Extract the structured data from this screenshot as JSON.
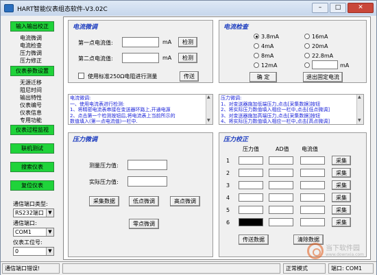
{
  "window": {
    "title": "HART智能仪表组态软件-V3.02C"
  },
  "left": {
    "btn_input_output": "输入输出校正",
    "items1": [
      "电流微调",
      "电流检查",
      "压力微调",
      "压力修正"
    ],
    "btn_params": "仪表参数设置",
    "items2": [
      "无源迁移",
      "阻尼时间",
      "输出特性",
      "仪表编号",
      "仪表信息",
      "专用功能"
    ],
    "btn_monitor": "仪表过程监视",
    "btn_test": "联机测试",
    "btn_search": "搜索仪表",
    "btn_reset": "复位仪表",
    "port_type_label": "通信端口类型:",
    "port_type_value": "RS232端口",
    "port_label": "通信端口:",
    "port_value": "COM1",
    "addr_label": "仪表工位号:",
    "addr_value": "0"
  },
  "current_trim": {
    "title": "电流微调",
    "first_label": "第一点电流值:",
    "second_label": "第二点电流值:",
    "unit": "mA",
    "detect": "检测",
    "std_check": "使用标准250Ω电阻进行测量",
    "send": "传送"
  },
  "current_check": {
    "title": "电流检查",
    "options": [
      "3.8mA",
      "16mA",
      "4mA",
      "20mA",
      "8mA",
      "22.8mA",
      "12mA",
      "mA"
    ],
    "confirm": "确 定",
    "exit": "退出固定电流"
  },
  "note_left": [
    "电流微调:",
    "一、使用电流表进行检测:",
    "  1、将精密电流表串接在变送器环路上,开通电源",
    "  2、点击第一个检测按钮后,将电流表上当前所示的",
    "     数值填入(第一点电流值)一栏中."
  ],
  "note_right": [
    "压力微调:",
    "1、对变送器施加低端压力,点击[采集数据]按钮",
    "2、将实际压力数值填入相应一栏中,点击[低点微调]",
    "3、对变送器施加高端压力,点击[采集数据]按钮",
    "4、将实际压力数值填入相应一栏中,点击[高点微调]"
  ],
  "pressure_trim": {
    "title": "压力微调",
    "measured_label": "测量压力值:",
    "actual_label": "实际压力值:",
    "collect": "采集数据",
    "low": "低点微调",
    "high": "高点微调",
    "zero": "零点微调"
  },
  "pressure_corr": {
    "title": "压力校正",
    "col_pressure": "压力值",
    "col_ad": "AD值",
    "col_current": "电流值",
    "rows": [
      "1",
      "2",
      "3",
      "4",
      "5",
      "6"
    ],
    "collect": "采集",
    "send": "传送数据",
    "clear": "清除数据"
  },
  "status": {
    "left": "通信端口错误!",
    "mode": "正常模式",
    "port": "端口: COM1"
  },
  "watermark": {
    "name": "当下软件园",
    "url": "www.downxia.com"
  }
}
